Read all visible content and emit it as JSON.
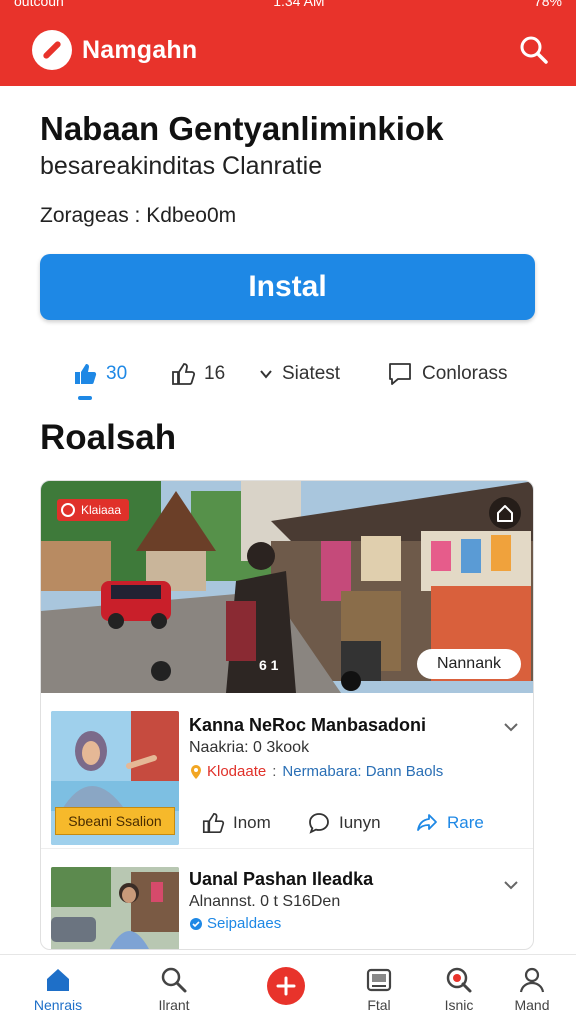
{
  "status_bar": {
    "carrier": "outcoun",
    "time": "1:34 AM",
    "battery": "78%"
  },
  "header": {
    "brand": "Namgahn",
    "logo_icon": "slash-logo-icon",
    "search_icon": "search-icon"
  },
  "app": {
    "title": "Nabaan Gentyanliminkiok",
    "subtitle": "besareakinditas Clanratie",
    "meta": "Zorageas : Kdbeo0m",
    "install_label": "Instal"
  },
  "stats": {
    "likes": "30",
    "comments": "16",
    "sort_label": "Siatest",
    "chat_label": "Conlorass"
  },
  "section": {
    "title": "Roalsah"
  },
  "hero": {
    "badge": "Klaiaaa",
    "count": "6 1",
    "chip": "Nannank"
  },
  "posts": [
    {
      "title": "Kanna NeRoc Manbasadoni",
      "meta": "Naakria: 0 3kook",
      "tag_a": "Klodaate",
      "tag_b": "Nermabara: Dann Baols",
      "thumb_label": "Sbeani Ssalion",
      "like_label": "Inom",
      "comment_label": "Iunyn",
      "share_label": "Rare"
    },
    {
      "title": "Uanal Pashan Ileadka",
      "meta": "Alnannst. 0 t S16Den",
      "tag_b": "Seipaldaes"
    }
  ],
  "bottom_nav": [
    {
      "label": "Nenrais",
      "icon": "home-icon",
      "active": true
    },
    {
      "label": "Ilrant",
      "icon": "search-icon"
    },
    {
      "label": "",
      "icon": "add-icon"
    },
    {
      "label": "Ftal",
      "icon": "feed-icon"
    },
    {
      "label": "Isnic",
      "icon": "topic-icon"
    },
    {
      "label": "Mand",
      "icon": "profile-icon"
    }
  ],
  "colors": {
    "brand_red": "#e8332b",
    "accent_blue": "#1e88e5",
    "badge_yellow": "#f6b92b"
  }
}
